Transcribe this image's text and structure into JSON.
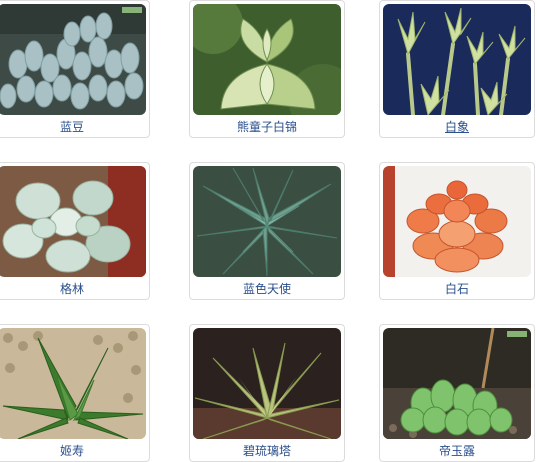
{
  "plants": [
    {
      "name": "蓝豆",
      "icon": "lan-dou-photo"
    },
    {
      "name": "熊童子白锦",
      "icon": "xiong-tong-zi-bai-jin-photo"
    },
    {
      "name": "白象",
      "icon": "bai-xiang-photo"
    },
    {
      "name": "格林",
      "icon": "ge-lin-photo"
    },
    {
      "name": "蓝色天使",
      "icon": "lan-se-tian-shi-photo"
    },
    {
      "name": "白石",
      "icon": "bai-shi-photo"
    },
    {
      "name": "姬寿",
      "icon": "ji-shou-photo"
    },
    {
      "name": "碧琉璃塔",
      "icon": "bi-liu-li-ta-photo"
    },
    {
      "name": "帝玉露",
      "icon": "di-yu-lu-photo"
    }
  ]
}
